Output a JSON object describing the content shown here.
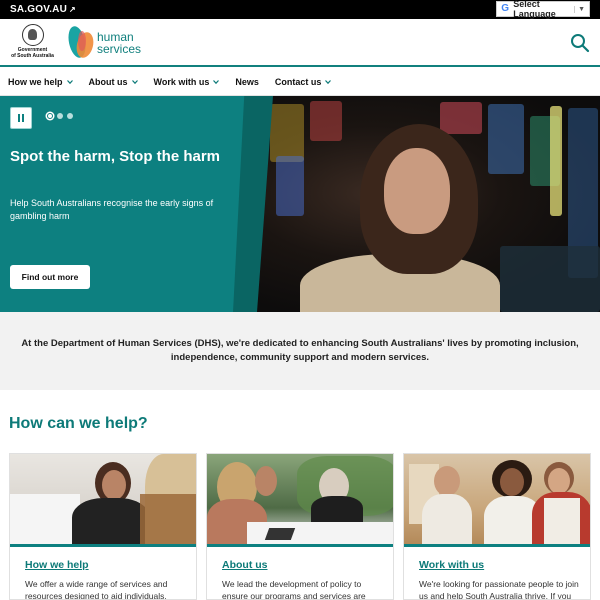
{
  "topbar": {
    "sa_gov_label": "SA.GOV.AU",
    "language_label": "Select Language",
    "language_arrow": "▼"
  },
  "header": {
    "crest_caption_line1": "Government",
    "crest_caption_line2": "of South Australia",
    "brand_line1": "human",
    "brand_line2": "services"
  },
  "nav": {
    "items": [
      {
        "label": "How we help",
        "has_dropdown": true
      },
      {
        "label": "About us",
        "has_dropdown": true
      },
      {
        "label": "Work with us",
        "has_dropdown": true
      },
      {
        "label": "News",
        "has_dropdown": false
      },
      {
        "label": "Contact us",
        "has_dropdown": true
      }
    ]
  },
  "hero": {
    "title": "Spot the harm, Stop the harm",
    "subtitle": "Help South Australians recognise the early signs of gambling harm",
    "button_label": "Find out more",
    "slide_count": 3,
    "active_slide": 1
  },
  "intro": {
    "text": "At the Department of Human Services (DHS), we're dedicated to enhancing South Australians' lives by promoting inclusion, independence, community support and modern services."
  },
  "help": {
    "title": "How can we help?",
    "cards": [
      {
        "title": "How we help",
        "description": "We offer a wide range of services and resources designed to aid individuals,"
      },
      {
        "title": "About us",
        "description": "We lead the development of policy to ensure our programs and services are"
      },
      {
        "title": "Work with us",
        "description": "We're looking for passionate people to join us and help South Australia thrive. If you"
      }
    ]
  },
  "colors": {
    "brand_teal": "#0d8080",
    "topbar": "#000000",
    "intro_bg": "#f2f2f2"
  }
}
